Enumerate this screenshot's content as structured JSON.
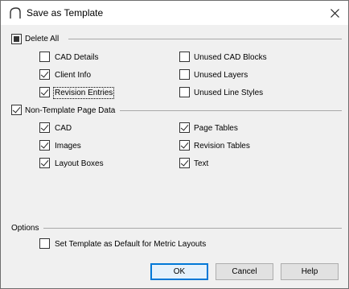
{
  "window": {
    "title": "Save as Template"
  },
  "groups": {
    "delete_all": {
      "label": "Delete All",
      "state": "indeterminate",
      "items": [
        {
          "label": "CAD Details",
          "checked": false
        },
        {
          "label": "Client Info",
          "checked": true
        },
        {
          "label": "Revision Entries",
          "checked": true
        },
        {
          "label": "Unused CAD Blocks",
          "checked": false
        },
        {
          "label": "Unused Layers",
          "checked": false
        },
        {
          "label": "Unused Line Styles",
          "checked": false
        }
      ]
    },
    "non_template": {
      "label": "Non-Template Page Data",
      "checked": true,
      "items": [
        {
          "label": "CAD",
          "checked": true
        },
        {
          "label": "Images",
          "checked": true
        },
        {
          "label": "Layout Boxes",
          "checked": true
        },
        {
          "label": "Page Tables",
          "checked": true
        },
        {
          "label": "Revision Tables",
          "checked": true
        },
        {
          "label": "Text",
          "checked": true
        }
      ]
    },
    "options": {
      "label": "Options",
      "items": [
        {
          "label": "Set Template as Default for Metric Layouts",
          "checked": false
        }
      ]
    }
  },
  "buttons": {
    "ok": "OK",
    "cancel": "Cancel",
    "help": "Help"
  },
  "colors": {
    "accent": "#0078d7",
    "background": "#f0f0f0"
  }
}
